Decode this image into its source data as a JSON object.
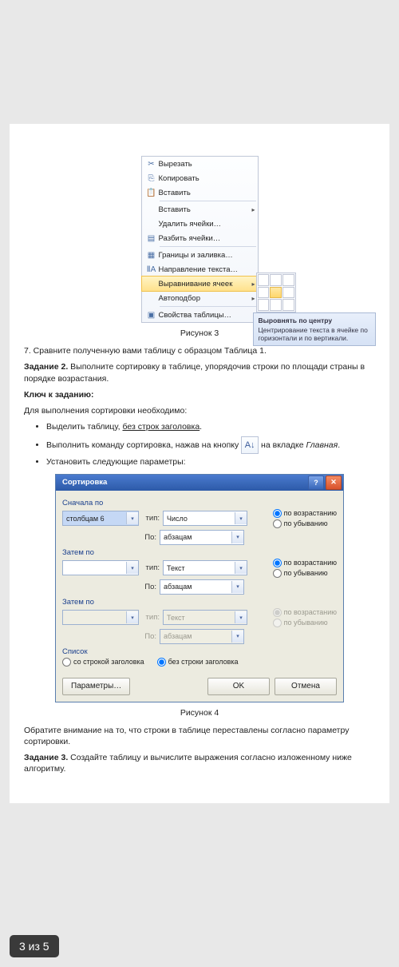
{
  "context_menu": {
    "items": [
      {
        "icon": "✂",
        "label": "Вырезать"
      },
      {
        "icon": "⎘",
        "label": "Копировать"
      },
      {
        "icon": "📋",
        "label": "Вставить"
      },
      {
        "icon": "",
        "label": "Вставить",
        "has_sub": true
      },
      {
        "icon": "",
        "label": "Удалить ячейки…"
      },
      {
        "icon": "▤",
        "label": "Разбить ячейки…"
      },
      {
        "icon": "▦",
        "label": "Границы и заливка…"
      },
      {
        "icon": "ⅡA",
        "label": "Направление текста…"
      },
      {
        "icon": "",
        "label": "Выравнивание ячеек",
        "has_sub": true,
        "highlight": true
      },
      {
        "icon": "",
        "label": "Автоподбор",
        "has_sub": true
      },
      {
        "icon": "▣",
        "label": "Свойства таблицы…"
      }
    ],
    "tooltip_title": "Выровнять по центру",
    "tooltip_body": "Центрирование текста в ячейке по горизонтали и по вертикали."
  },
  "captions": {
    "fig3": "Рисунок 3",
    "fig4": "Рисунок 4"
  },
  "body": {
    "step7": "7. Сравните полученную вами таблицу с образцом Таблица 1.",
    "task2_label": "Задание 2.",
    "task2_text": " Выполните сортировку в таблице, упорядочив строки по площади страны в порядке возрастания.",
    "key_label": "Ключ к заданию:",
    "lead": "Для выполнения сортировки необходимо:",
    "b1_a": "Выделить таблицу, ",
    "b1_u": "без строк заголовка",
    "b1_b": ".",
    "b2_a": "Выполнить команду сортировка, нажав на кнопку ",
    "b2_c": " на вкладке ",
    "b2_i": "Главная",
    "b2_d": ".",
    "b3": "Установить следующие параметры:",
    "note": "Обратите внимание на то, что строки в таблице переставлены согласно параметру сортировки.",
    "task3_label": "Задание 3.",
    "task3_text": " Создайте таблицу и вычислите выражения согласно изложенному ниже алгоритму."
  },
  "dialog": {
    "title": "Сортировка",
    "group1": "Сначала по",
    "group2": "Затем по",
    "group3": "Затем по",
    "list_label": "Список",
    "col_val": "столбцам 6",
    "type_lbl": "тип:",
    "by_lbl": "По:",
    "type_num": "Число",
    "type_text": "Текст",
    "by_para": "абзацам",
    "rad_asc": "по возрастанию",
    "rad_desc": "по убыванию",
    "opt_with_header": "со строкой заголовка",
    "opt_no_header": "без строки заголовка",
    "btn_params": "Параметры…",
    "btn_ok": "OK",
    "btn_cancel": "Отмена"
  },
  "page_indicator": "3 из 5"
}
